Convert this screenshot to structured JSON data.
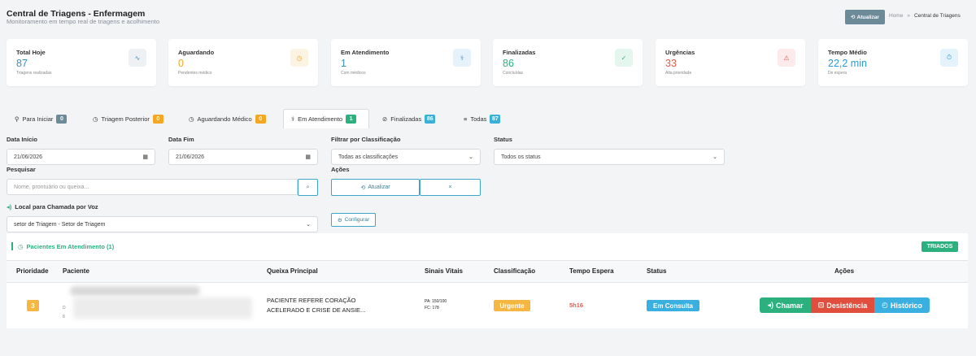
{
  "header": {
    "title": "Central de Triagens - Enfermagem",
    "subtitle": "Monitoramento em tempo real de triagens e acolhimento",
    "refresh_label": "Atualizar",
    "breadcrumb_home": "Home",
    "breadcrumb_sep": "»",
    "breadcrumb_current": "Central de Triagens"
  },
  "cards": [
    {
      "label": "Total Hoje",
      "value": "87",
      "sub": "Triagens realizadas",
      "color": "#3a8fb7",
      "icon": "activity-icon",
      "icon_bg": "#eef1f4"
    },
    {
      "label": "Aguardando",
      "value": "0",
      "sub": "Pendentes médico",
      "color": "#f5a623",
      "icon": "clock-icon",
      "icon_bg": "#fdf3e3"
    },
    {
      "label": "Em Atendimento",
      "value": "1",
      "sub": "Com médicos",
      "color": "#3a8fb7",
      "icon": "user-doctor-icon",
      "icon_bg": "#e6f2fb"
    },
    {
      "label": "Finalizadas",
      "value": "86",
      "sub": "Concluídas",
      "color": "#2bb07e",
      "icon": "check-circle-icon",
      "icon_bg": "#e5f6ef"
    },
    {
      "label": "Urgências",
      "value": "33",
      "sub": "Alta prioridade",
      "color": "#e05a4a",
      "icon": "warning-icon",
      "icon_bg": "#fdeaea"
    },
    {
      "label": "Tempo Médio",
      "value": "22,2 min",
      "sub": "De espera",
      "color": "#2a9ad0",
      "icon": "stopwatch-icon",
      "icon_bg": "#e4f3fb"
    }
  ],
  "tabs": [
    {
      "label": "Para Iniciar",
      "count": "0",
      "badge_color": "#6c8a97"
    },
    {
      "label": "Triagem Posterior",
      "count": "0",
      "badge_color": "#f5a623"
    },
    {
      "label": "Aguardando Médico",
      "count": "0",
      "badge_color": "#f5a623"
    },
    {
      "label": "Em Atendimento",
      "count": "1",
      "badge_color": "#2bb07e"
    },
    {
      "label": "Finalizadas",
      "count": "86",
      "badge_color": "#3ab0d8"
    },
    {
      "label": "Todas",
      "count": "87",
      "badge_color": "#3ab0d8"
    }
  ],
  "filters": {
    "start_label": "Data Início",
    "start_value": "21/06/2026",
    "end_label": "Data Fim",
    "end_value": "21/06/2026",
    "classification_label": "Filtrar por Classificação",
    "classification_value": "Todas as classificações",
    "status_label": "Status",
    "status_value": "Todos os status",
    "search_label": "Pesquisar",
    "search_placeholder": "Nome, prontuário ou queixa...",
    "actions_label": "Ações",
    "refresh_label": "Atualizar",
    "clear_label": "×",
    "voice_label": "Local para Chamada por Voz",
    "voice_value": "setor de Triagem - Setor de Triagem",
    "configure_label": "Configurar"
  },
  "table": {
    "title": "Pacientes Em Atendimento (1)",
    "triados_label": "TRIADOS",
    "columns": [
      "Prioridade",
      "Paciente",
      "Queixa Principal",
      "Sinais Vitais",
      "Classificação",
      "Tempo Espera",
      "Status",
      "Ações"
    ],
    "rows": [
      {
        "priority": "3",
        "patient_line1": "D",
        "patient_line2": "8",
        "complaint_line1": "PACIENTE REFERE CORAÇÃO",
        "complaint_line2": "ACELERADO E CRISE DE ANSIE...",
        "vitals_pa": "PA: 150/100",
        "vitals_fc": "FC: 178",
        "classification": "Urgente",
        "wait": "5h16",
        "status": "Em Consulta",
        "call_label": "Chamar",
        "withdraw_label": "Desistência",
        "history_label": "Histórico"
      }
    ]
  }
}
